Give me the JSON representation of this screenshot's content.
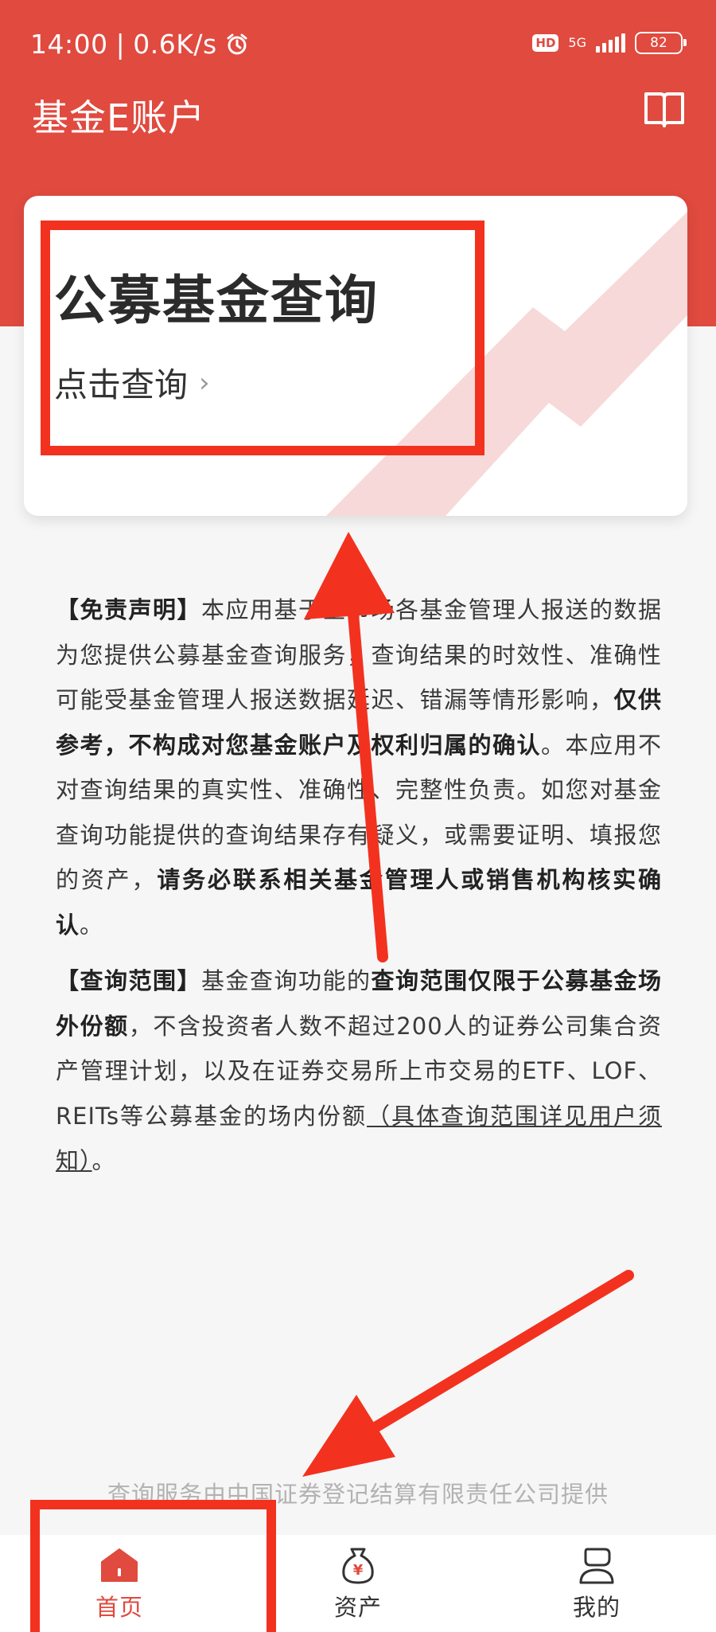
{
  "status_bar": {
    "time": "14:00",
    "speed": "0.6K/s",
    "hd": "HD",
    "network": "5G",
    "battery": "82"
  },
  "header": {
    "title": "基金E账户",
    "book_icon": "book-icon"
  },
  "card": {
    "title": "公募基金查询",
    "link_label": "点击查询",
    "chevron": "›"
  },
  "disclaimer": {
    "p1": {
      "heading": "【免责声明】",
      "text1": "本应用基于全市场各基金管理人报送的数据为您提供公募基金查询服务，查询结果的时效性、准确性可能受基金管理人报送数据延迟、错漏等情形影响，",
      "bold1": "仅供参考，不构成对您基金账户及权利归属的确认",
      "text2": "。本应用不对查询结果的真实性、准确性、完整性负责。如您对基金查询功能提供的查询结果存有疑义，或需要证明、填报您的资产，",
      "bold2": "请务必联系相关基金管理人或销售机构核实确认",
      "text3": "。"
    },
    "p2": {
      "heading": "【查询范围】",
      "text1": "基金查询功能的",
      "bold1": "查询范围仅限于公募基金场外份额",
      "text2": "，不含投资者人数不超过200人的证券公司集合资产管理计划，以及在证券交易所上市交易的ETF、LOF、REITs等公募基金的场内份额",
      "link": "（具体查询范围详见用户须知）",
      "text3": "。"
    }
  },
  "footer_note": "查询服务由中国证券登记结算有限责任公司提供",
  "tabs": [
    {
      "label": "首页",
      "icon": "home-icon",
      "active": true
    },
    {
      "label": "资产",
      "icon": "money-bag-icon",
      "active": false
    },
    {
      "label": "我的",
      "icon": "profile-icon",
      "active": false
    }
  ],
  "colors": {
    "brand_red": "#e04a3f",
    "annotation_red": "#f2321f",
    "text": "#3a3a3a"
  }
}
